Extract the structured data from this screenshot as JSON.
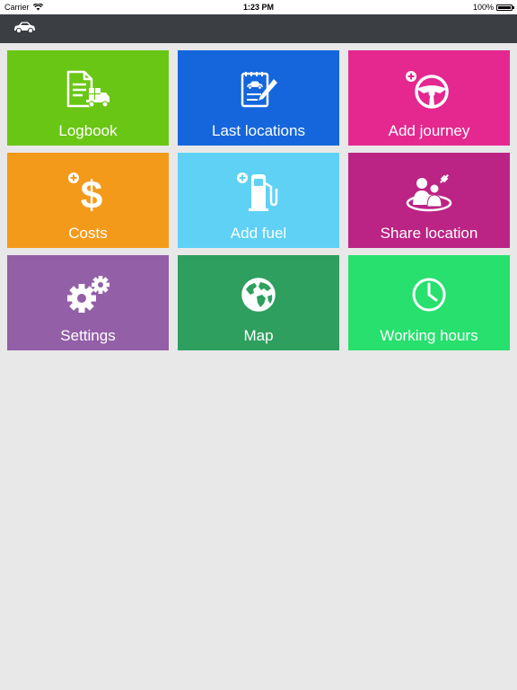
{
  "status": {
    "carrier": "Carrier",
    "time": "1:23 PM",
    "battery": "100%"
  },
  "nav": {
    "icon": "car-icon"
  },
  "tiles": [
    {
      "id": "logbook",
      "label": "Logbook",
      "color": "#6ac614",
      "icon": "logbook-icon"
    },
    {
      "id": "last-locations",
      "label": "Last locations",
      "color": "#1566dd",
      "icon": "notepad-car-icon"
    },
    {
      "id": "add-journey",
      "label": "Add journey",
      "color": "#e4288f",
      "icon": "steering-wheel-plus-icon"
    },
    {
      "id": "costs",
      "label": "Costs",
      "color": "#f49a1b",
      "icon": "dollar-plus-icon"
    },
    {
      "id": "add-fuel",
      "label": "Add fuel",
      "color": "#5fd1f5",
      "icon": "fuel-pump-plus-icon"
    },
    {
      "id": "share-location",
      "label": "Share location",
      "color": "#bb2485",
      "icon": "people-satellite-icon"
    },
    {
      "id": "settings",
      "label": "Settings",
      "color": "#935fa7",
      "icon": "gears-icon"
    },
    {
      "id": "map",
      "label": "Map",
      "color": "#2e9f5e",
      "icon": "globe-icon"
    },
    {
      "id": "working-hours",
      "label": "Working hours",
      "color": "#27e06e",
      "icon": "clock-icon"
    }
  ]
}
